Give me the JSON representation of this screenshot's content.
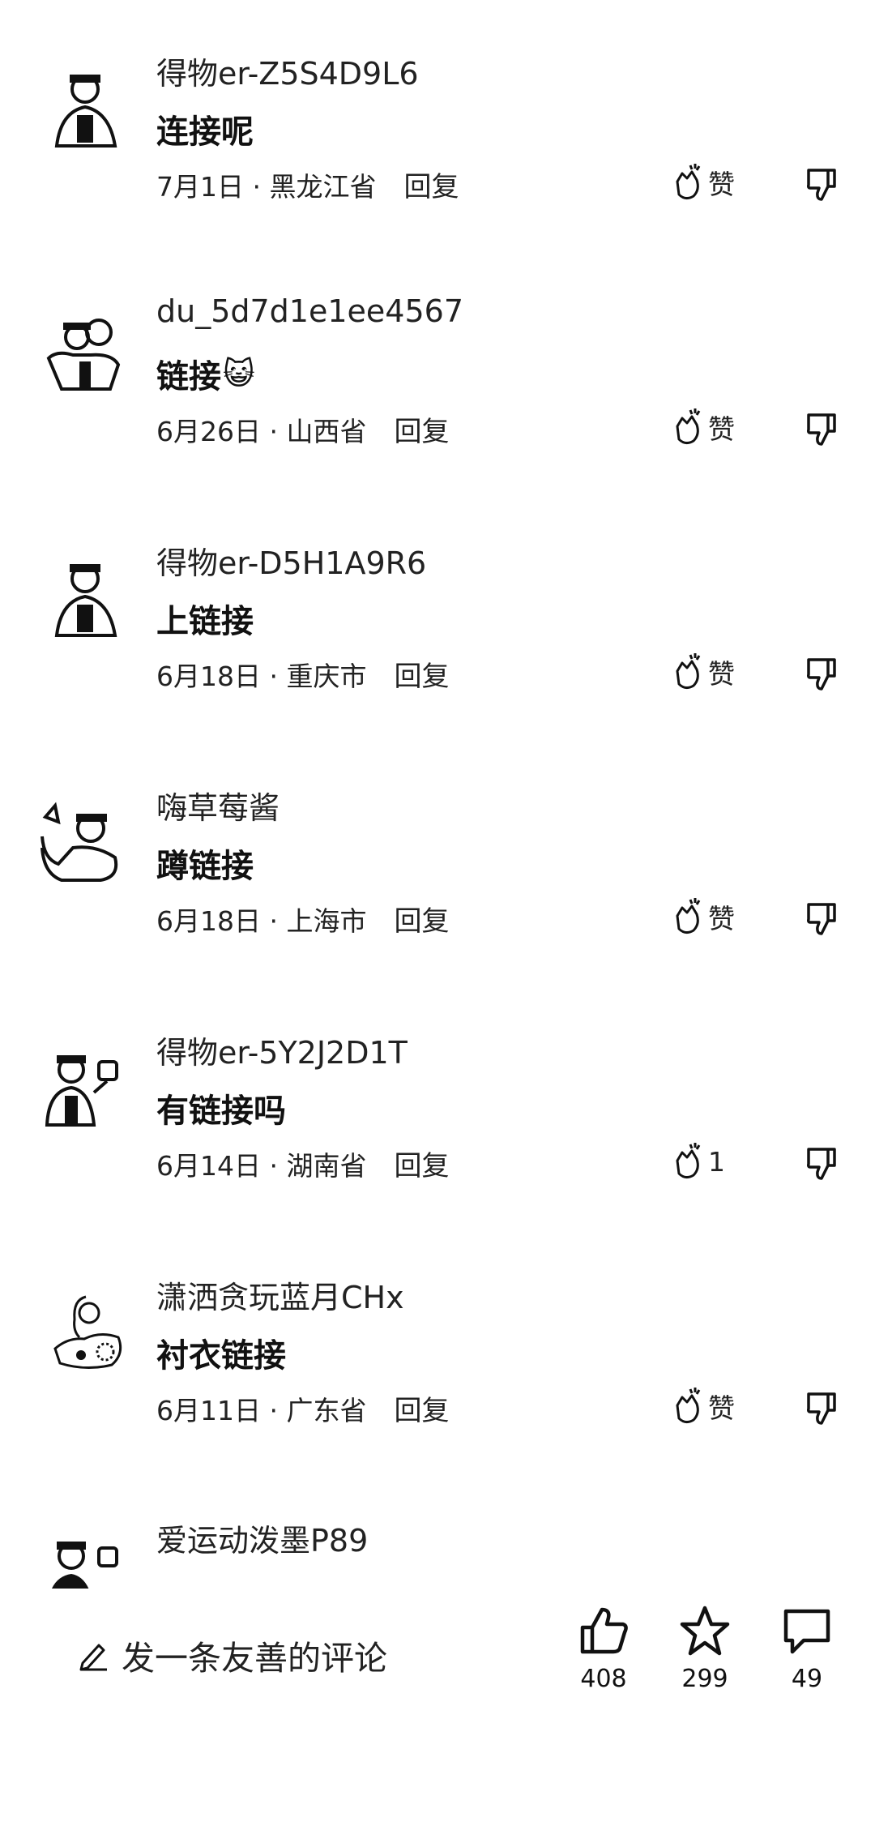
{
  "comments": [
    {
      "user": "得物er-Z5S4D9L6",
      "text": "连接呢",
      "date": "7月1日",
      "region": "黑龙江省",
      "reply": "回复",
      "likes": "赞"
    },
    {
      "user": "du_5d7d1e1ee4567",
      "text": "链接",
      "emoji": "😺",
      "date": "6月26日",
      "region": "山西省",
      "reply": "回复",
      "likes": "赞"
    },
    {
      "user": "得物er-D5H1A9R6",
      "text": "上链接",
      "date": "6月18日",
      "region": "重庆市",
      "reply": "回复",
      "likes": "赞"
    },
    {
      "user": "嗨草莓酱",
      "text": "蹲链接",
      "date": "6月18日",
      "region": "上海市",
      "reply": "回复",
      "likes": "赞"
    },
    {
      "user": "得物er-5Y2J2D1T",
      "text": "有链接吗",
      "date": "6月14日",
      "region": "湖南省",
      "reply": "回复",
      "likes": "1"
    },
    {
      "user": "潇洒贪玩蓝月CHx",
      "text": "衬衣链接",
      "date": "6月11日",
      "region": "广东省",
      "reply": "回复",
      "likes": "赞"
    },
    {
      "user": "爱运动泼墨P89"
    }
  ],
  "meta_sep": " · ",
  "bottom": {
    "comment_placeholder": "发一条友善的评论",
    "likes": "408",
    "favorites": "299",
    "comments": "49"
  },
  "icons": {
    "clap": "clap-icon",
    "dislike": "thumbs-down-icon",
    "pencil": "pencil-icon",
    "thumbs_up": "thumbs-up-icon",
    "star": "star-icon",
    "comment": "comment-bubble-icon"
  }
}
